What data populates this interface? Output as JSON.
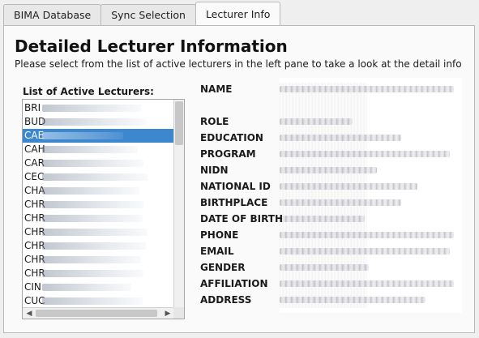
{
  "tabs": [
    {
      "label": "BIMA Database",
      "active": false
    },
    {
      "label": "Sync Selection",
      "active": false
    },
    {
      "label": "Lecturer Info",
      "active": true
    }
  ],
  "main": {
    "title": "Detailed Lecturer Information",
    "subtitle": "Please select from the list of active lecturers in the left pane to take a look at the detail info",
    "list_label": "List of Active Lecturers:",
    "lecturers": [
      "BRI",
      "BUD",
      "CAE",
      "CAH",
      "CAR",
      "CEC",
      "CHA",
      "CHR",
      "CHR",
      "CHR",
      "CHR",
      "CHR",
      "CHR",
      "CIN",
      "CUC"
    ],
    "selected_index": 2,
    "fields": [
      "NAME",
      "ROLE",
      "EDUCATION",
      "PROGRAM",
      "NIDN",
      "NATIONAL ID",
      "BIRTHPLACE",
      "DATE OF BIRTH",
      "PHONE",
      "EMAIL",
      "GENDER",
      "AFFILIATION",
      "ADDRESS"
    ]
  },
  "colors": {
    "selection": "#3d87cf",
    "panel": "#fafafa",
    "window": "#efefef"
  },
  "icons": {
    "scroll_left": "triangle-left-icon",
    "scroll_right": "triangle-right-icon"
  }
}
